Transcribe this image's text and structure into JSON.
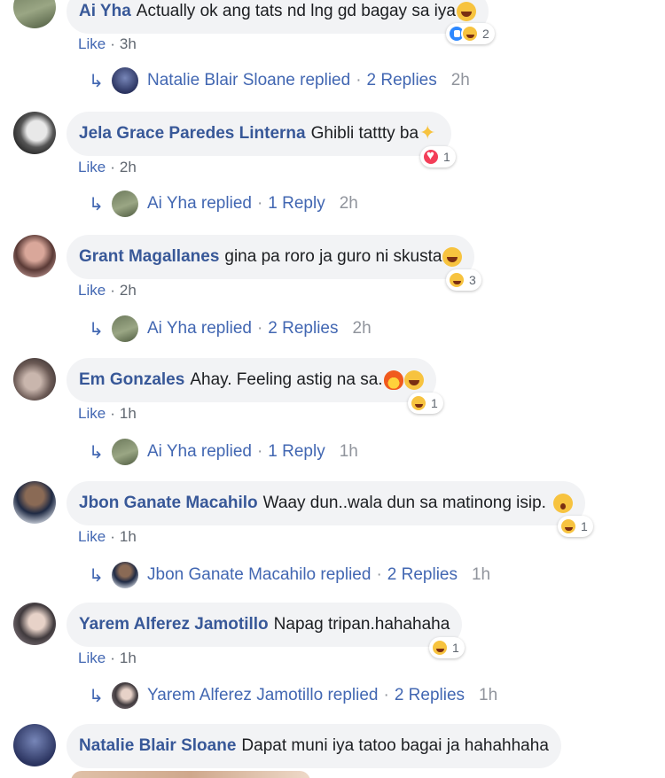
{
  "comments": [
    {
      "author": "Ai Yha",
      "text": "Actually ok ang tats nd lng gd bagay sa iya",
      "emoji": "laugh-emoji",
      "reaction_count": "2",
      "reactions": [
        "like",
        "haha"
      ],
      "like_label": "Like",
      "time": "3h",
      "reply": {
        "label": "Natalie Blair Sloane replied",
        "count": "2 Replies",
        "time": "2h"
      }
    },
    {
      "author": "Jela Grace Paredes Linterna",
      "text": "Ghibli tattty ba",
      "emoji": "sparkles-emoji",
      "reaction_count": "1",
      "reactions": [
        "love"
      ],
      "like_label": "Like",
      "time": "2h",
      "reply": {
        "label": "Ai Yha replied",
        "count": "1 Reply",
        "time": "2h"
      }
    },
    {
      "author": "Grant Magallanes",
      "text": "gina pa roro ja guro ni skusta",
      "emoji": "laugh-emoji",
      "reaction_count": "3",
      "reactions": [
        "haha"
      ],
      "like_label": "Like",
      "time": "2h",
      "reply": {
        "label": "Ai Yha replied",
        "count": "2 Replies",
        "time": "2h"
      }
    },
    {
      "author": "Em Gonzales",
      "text": "Ahay. Feeling astig na sa.",
      "emoji": "fire-laugh-emoji",
      "reaction_count": "1",
      "reactions": [
        "haha"
      ],
      "like_label": "Like",
      "time": "1h",
      "reply": {
        "label": "Ai Yha replied",
        "count": "1 Reply",
        "time": "1h"
      }
    },
    {
      "author": "Jbon Ganate Macahilo",
      "text": "Waay dun..wala dun sa matinong isip.",
      "emoji": "shocked-emoji",
      "reaction_count": "1",
      "reactions": [
        "haha"
      ],
      "like_label": "Like",
      "time": "1h",
      "reply": {
        "label": "Jbon Ganate Macahilo replied",
        "count": "2 Replies",
        "time": "1h"
      }
    },
    {
      "author": "Yarem Alferez Jamotillo",
      "text": "Napag tripan.hahahaha",
      "emoji": "",
      "reaction_count": "1",
      "reactions": [
        "haha"
      ],
      "like_label": "Like",
      "time": "1h",
      "reply": {
        "label": "Yarem Alferez Jamotillo replied",
        "count": "2 Replies",
        "time": "1h"
      }
    },
    {
      "author": "Natalie Blair Sloane",
      "text": "Dapat muni iya tatoo bagai ja hahahhaha",
      "emoji": "",
      "like_label": "",
      "time": ""
    }
  ],
  "reply_separator": "·",
  "colors": {
    "link": "#385898",
    "bubble": "#f2f3f5",
    "meta": "#606770",
    "haha": "#f7c33f",
    "love": "#f33e58",
    "like": "#2d88ff"
  }
}
